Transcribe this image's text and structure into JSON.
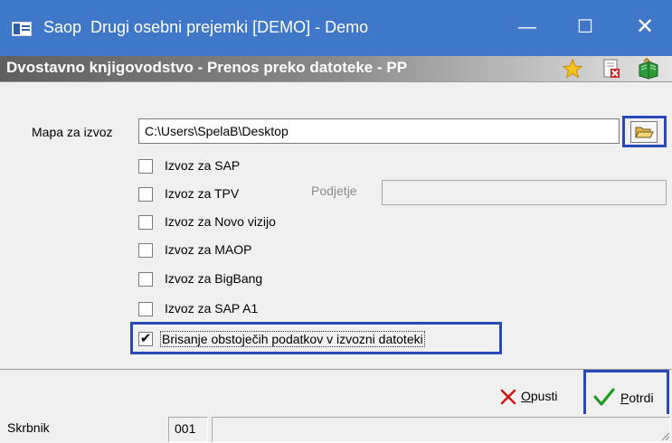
{
  "window": {
    "title": "Saop  Drugi osebni prejemki [DEMO] - Demo",
    "controls": {
      "minimize": "—",
      "maximize": "☐",
      "close": "✕"
    }
  },
  "header": {
    "title": "Dvostavno knjigovodstvo - Prenos preko datoteke - PP",
    "icons": [
      "star-icon",
      "document-delete-icon",
      "book-exit-icon"
    ]
  },
  "form": {
    "folder_label": "Mapa za izvoz",
    "folder_value": "C:\\Users\\SpelaB\\Desktop",
    "podjetje_label": "Podjetje",
    "podjetje_value": "",
    "checkboxes": [
      {
        "label": "Izvoz za SAP",
        "checked": false
      },
      {
        "label": "Izvoz za TPV",
        "checked": false
      },
      {
        "label": "Izvoz za Novo vizijo",
        "checked": false
      },
      {
        "label": "Izvoz za MAOP",
        "checked": false
      },
      {
        "label": "Izvoz za BigBang",
        "checked": false
      },
      {
        "label": "Izvoz za SAP A1",
        "checked": false
      },
      {
        "label": "Brisanje obstoječih podatkov v izvozni datoteki",
        "checked": true
      }
    ]
  },
  "buttons": {
    "cancel_prefix": "O",
    "cancel_rest": "pusti",
    "confirm_prefix": "P",
    "confirm_rest": "otrdi"
  },
  "status": {
    "user": "Skrbnik",
    "code": "001",
    "message": ""
  },
  "colors": {
    "titlebar": "#3f78c9",
    "highlight": "#2a49b8",
    "cancel_icon": "#d01515",
    "confirm_icon": "#1a9a1a"
  }
}
